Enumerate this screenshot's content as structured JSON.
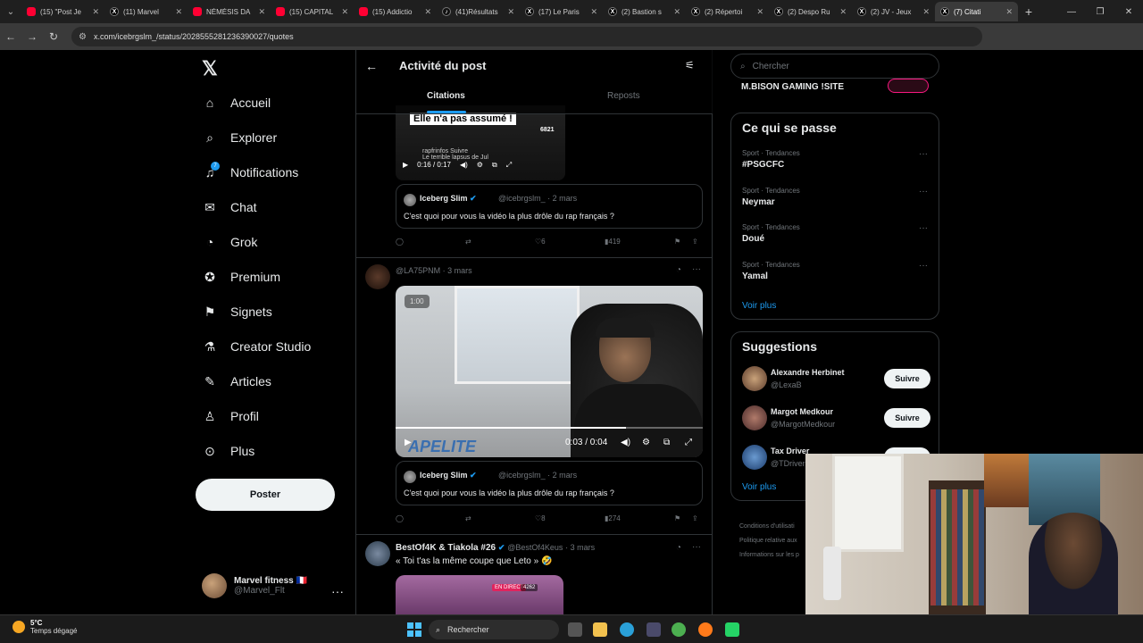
{
  "browser": {
    "tabs": [
      {
        "label": "(15) \"Post Je",
        "icon": "youtube"
      },
      {
        "label": "(11) Marvel",
        "icon": "x"
      },
      {
        "label": "NÉMÉSIS DA",
        "icon": "youtube"
      },
      {
        "label": "(15) CAPITAL",
        "icon": "youtube"
      },
      {
        "label": "(15) Addictio",
        "icon": "youtube"
      },
      {
        "label": "(41)Résultats",
        "icon": "tiktok"
      },
      {
        "label": "(17) Le Paris",
        "icon": "x"
      },
      {
        "label": "(2) Bastion s",
        "icon": "x"
      },
      {
        "label": "(2) Répertoi",
        "icon": "x"
      },
      {
        "label": "(2) Despo Ru",
        "icon": "x"
      },
      {
        "label": "(2) JV - Jeux",
        "icon": "x"
      },
      {
        "label": "(7) Citati",
        "icon": "x",
        "active": true
      }
    ],
    "url": "x.com/icebrgslm_/status/2028555281236390027/quotes"
  },
  "nav": {
    "items": [
      {
        "label": "Accueil",
        "icon": "home-icon"
      },
      {
        "label": "Explorer",
        "icon": "search-icon"
      },
      {
        "label": "Notifications",
        "icon": "bell-icon",
        "badge": "7"
      },
      {
        "label": "Chat",
        "icon": "mail-icon"
      },
      {
        "label": "Grok",
        "icon": "grok-icon"
      },
      {
        "label": "Premium",
        "icon": "premium-icon"
      },
      {
        "label": "Signets",
        "icon": "bookmark-icon"
      },
      {
        "label": "Creator Studio",
        "icon": "flask-icon"
      },
      {
        "label": "Articles",
        "icon": "article-icon"
      },
      {
        "label": "Profil",
        "icon": "user-icon"
      },
      {
        "label": "Plus",
        "icon": "more-icon"
      }
    ],
    "post_button": "Poster",
    "account": {
      "name": "Marvel fitness 🇫🇷",
      "handle": "@Marvel_Flt"
    }
  },
  "main": {
    "title": "Activité du post",
    "tabs": {
      "citations": "Citations",
      "reposts": "Reposts"
    },
    "video1": {
      "caption": "Elle n'a pas assumé !",
      "views": "6821",
      "channel": "rapfrinfos",
      "follow": "Suivre",
      "subtitle": "Le terrible lapsus de Jul",
      "time": "0:16 / 0:17"
    },
    "quote": {
      "name": "Iceberg Slim",
      "handle": "@icebrgslm_",
      "date": "· 2 mars",
      "text": "C'est quoi pour vous la vidéo la plus drôle du rap français ?"
    },
    "tweet1_actions": {
      "likes": "6",
      "views": "419"
    },
    "tweet2": {
      "handle": "@LA75PNM",
      "date": "· 3 mars",
      "video_badge": "1:00",
      "video_time": "0:03 / 0:04",
      "logo": "APELITE",
      "progress_fraction": 0.75
    },
    "tweet2_actions": {
      "likes": "8",
      "views": "274"
    },
    "tweet3": {
      "name": "BestOf4K & Tiakola #26",
      "handle": "@BestOf4Keus",
      "date": "· 3 mars",
      "text": "« Toi t'as la même coupe que Leto » 🤣",
      "live_label": "EN DIRECT",
      "live_count": "4262"
    }
  },
  "right": {
    "search_placeholder": "Chercher",
    "top_trend": "M.BISON GAMING !SITE",
    "happening_title": "Ce qui se passe",
    "trends": [
      {
        "category": "Sport · Tendances",
        "name": "#PSGCFC"
      },
      {
        "category": "Sport · Tendances",
        "name": "Neymar"
      },
      {
        "category": "Sport · Tendances",
        "name": "Doué"
      },
      {
        "category": "Sport · Tendances",
        "name": "Yamal"
      }
    ],
    "see_more": "Voir plus",
    "suggestions_title": "Suggestions",
    "suggestions": [
      {
        "name": "Alexandre Herbinet",
        "handle": "@LexaB",
        "follow": "Suivre"
      },
      {
        "name": "Margot Medkour",
        "handle": "@MargotMedkour",
        "follow": "Suivre"
      },
      {
        "name": "Tax Driver",
        "handle": "@TDriver",
        "follow": "Suivre"
      }
    ],
    "footer": [
      "Conditions d'utilisati",
      "Politique relative aux",
      "Informations sur les p"
    ]
  },
  "taskbar": {
    "temp": "5°C",
    "weather": "Temps dégagé",
    "search": "Rechercher"
  },
  "colors": {
    "accent": "#1d9bf0",
    "bg": "#000000",
    "border": "#2f3336"
  }
}
